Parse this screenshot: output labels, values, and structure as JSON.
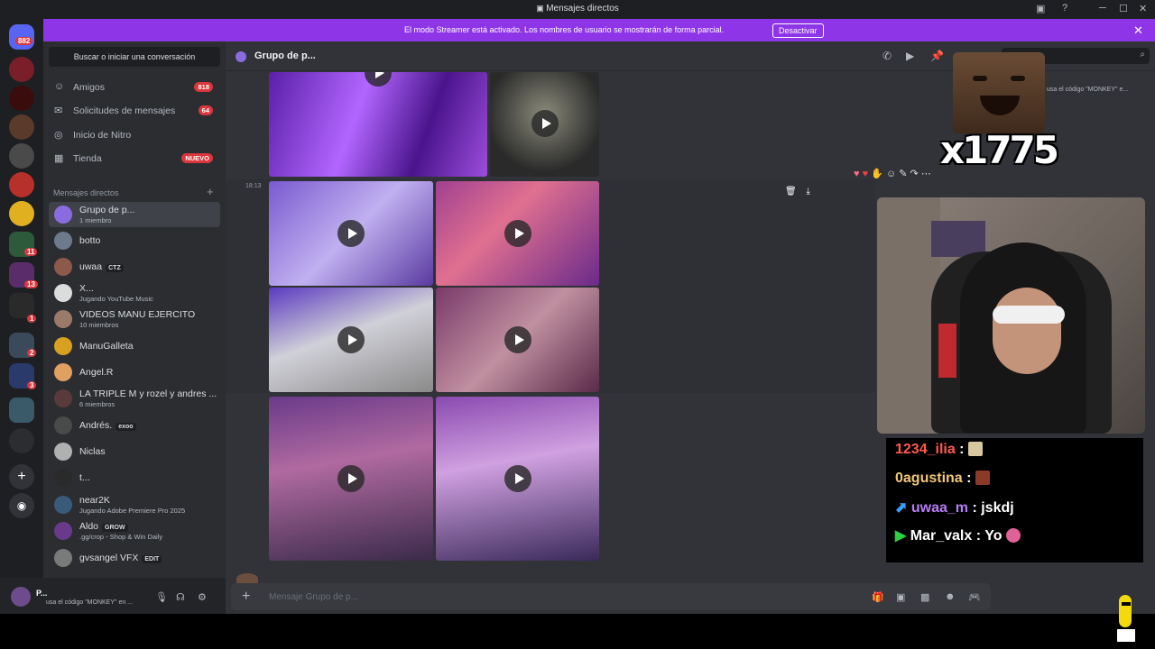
{
  "window": {
    "title": "Mensajes directos"
  },
  "servers": {
    "home_badge": "882",
    "badges": [
      "11",
      "13",
      "1",
      "2",
      "3"
    ]
  },
  "banner": {
    "text": "El modo Streamer está activado. Los nombres de usuario se mostrarán de forma parcial.",
    "button": "Desactivar"
  },
  "sidebar": {
    "search": "Buscar o iniciar una conversación",
    "nav": [
      {
        "label": "Amigos",
        "badge": "818",
        "icon": "friends-icon"
      },
      {
        "label": "Solicitudes de mensajes",
        "badge": "64",
        "icon": "mail-icon"
      },
      {
        "label": "Inicio de Nitro",
        "badge": "",
        "icon": "nitro-icon"
      },
      {
        "label": "Tienda",
        "badge": "NUEVO",
        "icon": "shop-icon"
      }
    ],
    "dm_header": "Mensajes directos",
    "dms": [
      {
        "name": "Grupo de p...",
        "sub": "1 miembro"
      },
      {
        "name": "botto",
        "sub": ""
      },
      {
        "name": "uwaa",
        "tag": "CTZ",
        "sub": ""
      },
      {
        "name": "X...",
        "sub": "Jugando YouTube Music"
      },
      {
        "name": "VIDEOS MANU EJERCITO",
        "sub": "10 miembros"
      },
      {
        "name": "ManuGalleta",
        "sub": ""
      },
      {
        "name": "Angel.R",
        "sub": ""
      },
      {
        "name": "LA TRIPLE M y rozel y andres ...",
        "sub": "6 miembros"
      },
      {
        "name": "Andrés.",
        "tag": "exoo",
        "sub": ""
      },
      {
        "name": "Niclas",
        "sub": ""
      },
      {
        "name": "t...",
        "sub": ""
      },
      {
        "name": "near2K",
        "sub": "Jugando Adobe Premiere Pro 2025"
      },
      {
        "name": "Aldo",
        "tag": "GROW",
        "sub": ".gg/crop - Shop & Win Daily"
      },
      {
        "name": "gvsangel VFX",
        "tag": "EDIT",
        "sub": ""
      }
    ]
  },
  "user_panel": {
    "name": "P...",
    "status": "usa el código \"MONKEY\" en ..."
  },
  "chat": {
    "header_name": "Grupo de p...",
    "timestamp": "18:13",
    "member_peek": "usa el código \"MONKEY\" e...",
    "composer_placeholder": "Mensaje Grupo de p..."
  },
  "overlay": {
    "meme_text": "x1775",
    "stream_chat": [
      {
        "user": "1234_ilia",
        "msg": "",
        "color": "#ff5a4f",
        "emote": "#d8c8a0"
      },
      {
        "user": "0agustina",
        "msg": "",
        "color": "#f2c77a",
        "emote": "#8b3a2a"
      },
      {
        "user": "uwaa_m",
        "msg": "jskdj",
        "color": "#b77cf4",
        "emote": ""
      },
      {
        "user": "Mar_valx",
        "msg": "Yo",
        "color": "#ffffff",
        "emote": "#e0609a"
      }
    ]
  },
  "colors": {
    "accent": "#8f35e8",
    "badge": "#da373c"
  }
}
